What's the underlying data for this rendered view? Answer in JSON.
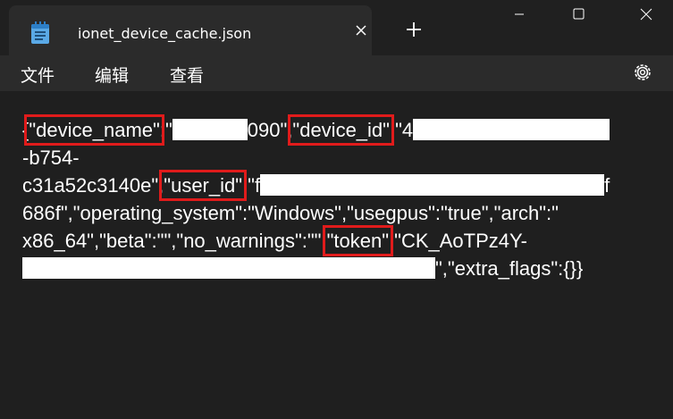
{
  "window": {
    "tab_title": "ionet_device_cache.json",
    "icons": {
      "app": "notepad-icon",
      "close_tab": "close-icon",
      "new_tab": "plus-icon",
      "minimize": "minimize-icon",
      "maximize": "maximize-icon",
      "close": "close-icon",
      "settings": "gear-icon"
    }
  },
  "menu": {
    "file": "文件",
    "edit": "编辑",
    "view": "查看"
  },
  "content": {
    "l1_open": "{",
    "key_device_name": "\"device_name\"",
    "l1_colon1": ":\"",
    "l1_val_tail": "090\",",
    "key_device_id": "\"device_id\"",
    "l1_colon2": ":\"4",
    "l2": "-b754-",
    "l3_pre": "c31a52c3140e\",",
    "key_user_id": "\"user_id\"",
    "l3_colon": ":\"f",
    "l3_tail": "f",
    "l4": "686f\",\"operating_system\":\"Windows\",\"usegpus\":\"true\",\"arch\":\"",
    "l5_pre": "x86_64\",\"beta\":\"\",\"no_warnings\":\"\",",
    "key_token": "\"token\"",
    "l5_post": ":\"CK_AoTPz4Y-",
    "l6_tail": "\",\"extra_flags\":{}}"
  },
  "colors": {
    "highlight": "#e01b1b",
    "background": "#1f1f1f",
    "tab": "#2b2b2b"
  }
}
